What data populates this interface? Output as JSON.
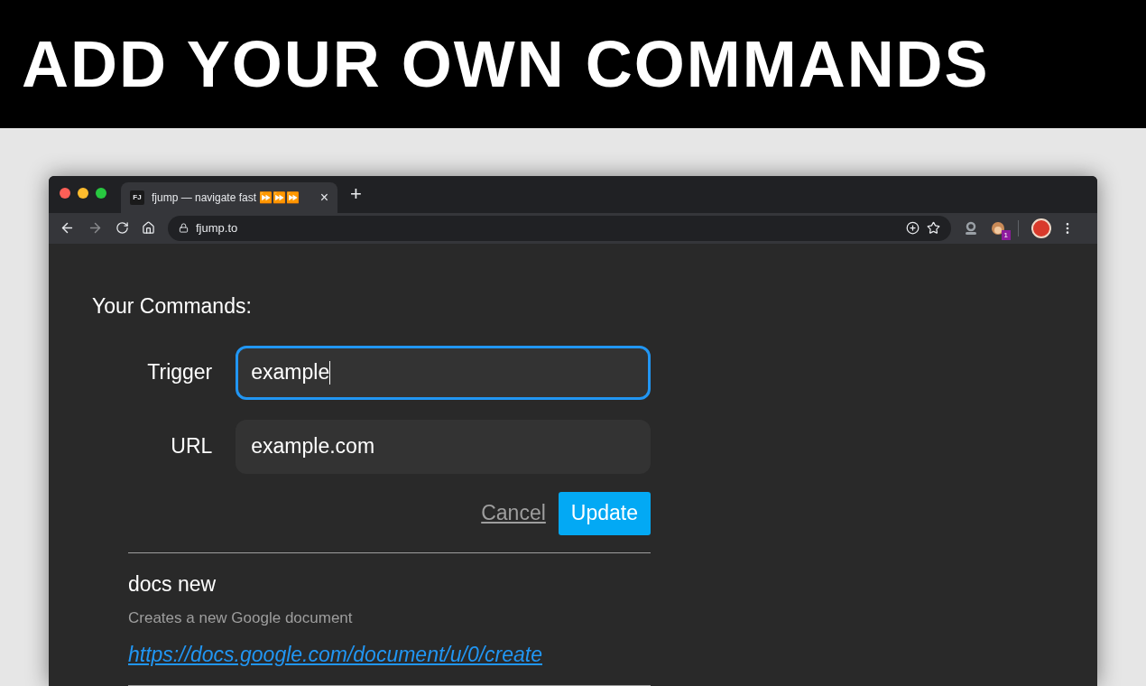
{
  "banner": {
    "title": "ADD YOUR OWN COMMANDS"
  },
  "browser": {
    "tab": {
      "favicon": "FJ",
      "title": "fjump — navigate fast ⏩⏩⏩",
      "close": "×"
    },
    "new_tab": "+",
    "address": "fjump.to",
    "extension_badge": "1"
  },
  "page": {
    "heading": "Your Commands:",
    "fields": [
      {
        "label": "Trigger",
        "value": "example",
        "focused": true
      },
      {
        "label": "URL",
        "value": "example.com",
        "focused": false
      }
    ],
    "cancel": "Cancel",
    "update": "Update",
    "commands": [
      {
        "trigger": "docs new",
        "description": "Creates a new Google document",
        "url": "https://docs.google.com/document/u/0/create"
      }
    ]
  }
}
